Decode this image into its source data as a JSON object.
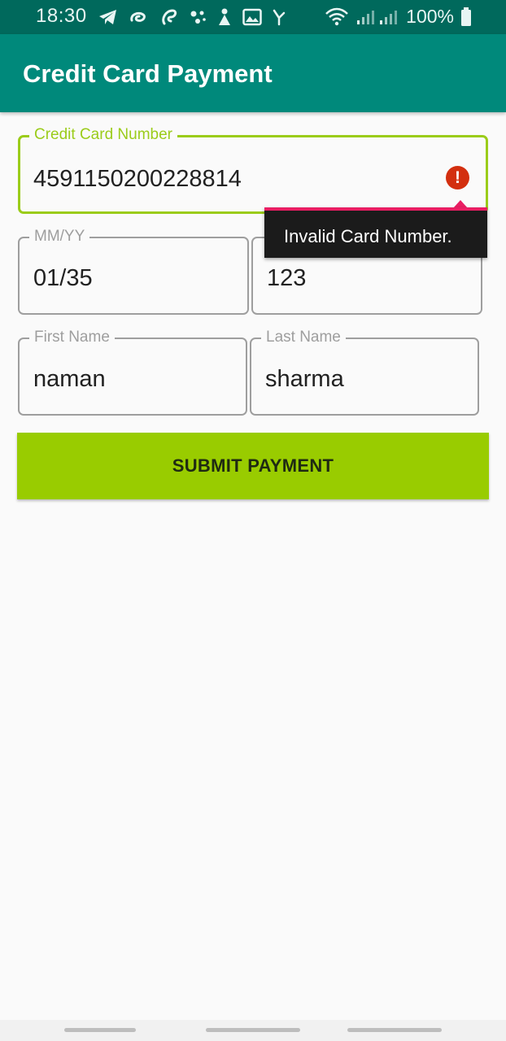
{
  "status_bar": {
    "time": "18:30",
    "battery_percent": "100%",
    "icons": [
      "telegram-icon",
      "airtel-icon",
      "swirl-icon",
      "dots-icon",
      "figure-icon",
      "gallery-icon",
      "missed-call-icon",
      "wifi-icon",
      "signal-icon",
      "battery-icon"
    ]
  },
  "app_bar": {
    "title": "Credit Card Payment"
  },
  "form": {
    "card_number": {
      "label": "Credit Card Number",
      "value": "4591150200228814",
      "error": "Invalid Card Number."
    },
    "expiry": {
      "label": "MM/YY",
      "value": "01/35"
    },
    "cvv": {
      "value": "123"
    },
    "first_name": {
      "label": "First Name",
      "value": "naman"
    },
    "last_name": {
      "label": "Last Name",
      "value": "sharma"
    },
    "submit_label": "SUBMIT PAYMENT"
  },
  "colors": {
    "status_bar": "#00695c",
    "app_bar": "#00897b",
    "accent": "#9bcc1a",
    "button": "#99cc00",
    "error": "#d32f0f",
    "tooltip_bg": "#1b1b1b",
    "tooltip_line": "#e91e63"
  }
}
